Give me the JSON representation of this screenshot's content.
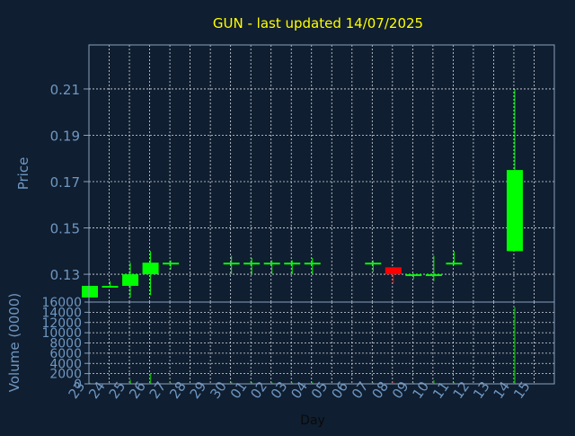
{
  "chart_data": {
    "type": "candlestick",
    "title": "GUN - last updated 14/07/2025",
    "xlabel": "Day",
    "ylabel": "Price",
    "volume_label": "Volume (0000)",
    "grid": true,
    "x_tick_labels": [
      "23",
      "24",
      "25",
      "26",
      "27",
      "28",
      "29",
      "30",
      "01",
      "02",
      "03",
      "04",
      "05",
      "06",
      "07",
      "08",
      "09",
      "10",
      "11",
      "12",
      "13",
      "14",
      "15"
    ],
    "price_ticks": [
      "0.13",
      "0.15",
      "0.17",
      "0.19",
      "0.21"
    ],
    "price_tick_values": [
      0.13,
      0.15,
      0.17,
      0.19,
      0.21
    ],
    "price_ylim": [
      0.118,
      0.229
    ],
    "volume_ticks": [
      "0",
      "2000",
      "4000",
      "6000",
      "8000",
      "10000",
      "12000",
      "14000",
      "16000"
    ],
    "volume_tick_values": [
      0,
      2000,
      4000,
      6000,
      8000,
      10000,
      12000,
      14000,
      16000
    ],
    "volume_ylim": [
      0,
      16000
    ],
    "colors": {
      "background": "#0f1e30",
      "title": "#ffff00",
      "text": "#6f97c2",
      "frame": "#8aa0bc",
      "grid": "#d8dce4",
      "up": "#00ff00",
      "down": "#ff0000",
      "volume_up": "#10a010",
      "volume_down": "#b00000"
    },
    "candles": [
      {
        "day": "23",
        "open": 0.12,
        "high": 0.125,
        "low": 0.12,
        "close": 0.125,
        "volume": 200
      },
      {
        "day": "24",
        "open": 0.125,
        "high": 0.127,
        "low": 0.125,
        "close": 0.125,
        "volume": 150
      },
      {
        "day": "25",
        "open": 0.125,
        "high": 0.135,
        "low": 0.12,
        "close": 0.13,
        "volume": 800
      },
      {
        "day": "26",
        "open": 0.13,
        "high": 0.14,
        "low": 0.121,
        "close": 0.135,
        "volume": 2000
      },
      {
        "day": "27",
        "open": 0.135,
        "high": 0.136,
        "low": 0.132,
        "close": 0.135,
        "volume": 250
      },
      {
        "day": "30",
        "open": 0.135,
        "high": 0.138,
        "low": 0.13,
        "close": 0.135,
        "volume": 400
      },
      {
        "day": "01",
        "open": 0.135,
        "high": 0.137,
        "low": 0.13,
        "close": 0.135,
        "volume": 350
      },
      {
        "day": "02",
        "open": 0.135,
        "high": 0.136,
        "low": 0.13,
        "close": 0.135,
        "volume": 300
      },
      {
        "day": "03",
        "open": 0.135,
        "high": 0.136,
        "low": 0.13,
        "close": 0.135,
        "volume": 250
      },
      {
        "day": "04",
        "open": 0.135,
        "high": 0.137,
        "low": 0.13,
        "close": 0.135,
        "volume": 300
      },
      {
        "day": "07",
        "open": 0.135,
        "high": 0.136,
        "low": 0.131,
        "close": 0.135,
        "volume": 250
      },
      {
        "day": "08",
        "open": 0.133,
        "high": 0.133,
        "low": 0.126,
        "close": 0.13,
        "volume": 500
      },
      {
        "day": "09",
        "open": 0.13,
        "high": 0.13,
        "low": 0.128,
        "close": 0.13,
        "volume": 200
      },
      {
        "day": "10",
        "open": 0.13,
        "high": 0.138,
        "low": 0.127,
        "close": 0.13,
        "volume": 700
      },
      {
        "day": "11",
        "open": 0.135,
        "high": 0.14,
        "low": 0.134,
        "close": 0.135,
        "volume": 300
      },
      {
        "day": "14",
        "open": 0.14,
        "high": 0.21,
        "low": 0.14,
        "close": 0.175,
        "volume": 15000
      }
    ]
  }
}
